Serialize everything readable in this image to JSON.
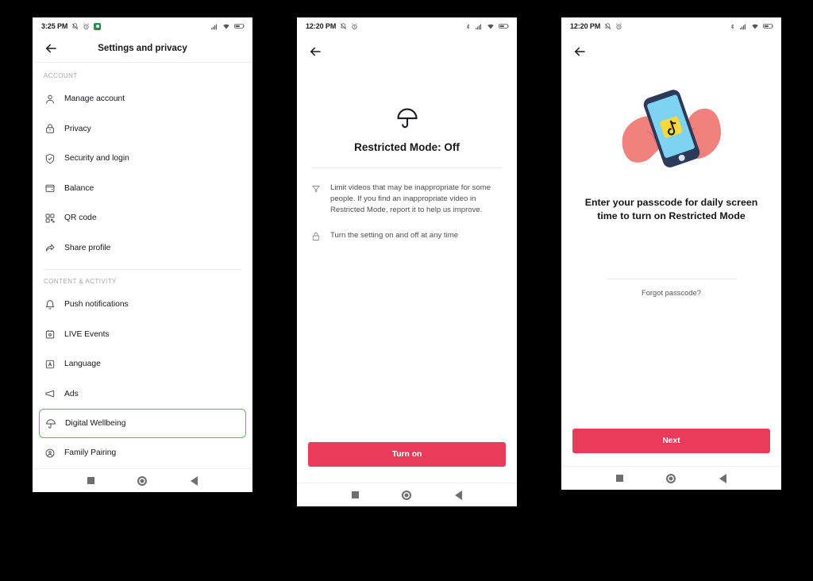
{
  "colors": {
    "accent_red": "#EB3B5A",
    "highlight_green": "#5CB85C",
    "page_background": "#000000",
    "screen_background": "#FFFFFF",
    "hand_pink": "#F2807D",
    "phone_navy": "#2E3A59",
    "phone_screen_blue": "#7FD3F2",
    "logo_yellow": "#FFD93B"
  },
  "screens": {
    "settings": {
      "status_bar": {
        "time": "3:25 PM",
        "left_icons": [
          "bell-mute-icon",
          "alarm-clock-icon",
          "app-badge-icon"
        ],
        "right_icons": [
          "cellular-signal-icon",
          "wifi-icon",
          "battery-icon"
        ]
      },
      "header": {
        "back_label": "Back",
        "title": "Settings and privacy"
      },
      "sections": [
        {
          "label": "ACCOUNT",
          "items": [
            {
              "label": "Manage account",
              "icon": "person-icon",
              "highlighted": false
            },
            {
              "label": "Privacy",
              "icon": "lock-icon",
              "highlighted": false
            },
            {
              "label": "Security and login",
              "icon": "shield-check-icon",
              "highlighted": false
            },
            {
              "label": "Balance",
              "icon": "wallet-icon",
              "highlighted": false
            },
            {
              "label": "QR code",
              "icon": "qr-code-icon",
              "highlighted": false
            },
            {
              "label": "Share profile",
              "icon": "share-arrow-icon",
              "highlighted": false
            }
          ]
        },
        {
          "label": "CONTENT & ACTIVITY",
          "items": [
            {
              "label": "Push notifications",
              "icon": "bell-icon",
              "highlighted": false
            },
            {
              "label": "LIVE Events",
              "icon": "calendar-icon",
              "highlighted": false
            },
            {
              "label": "Language",
              "icon": "letter-a-box-icon",
              "highlighted": false
            },
            {
              "label": "Ads",
              "icon": "megaphone-icon",
              "highlighted": false
            },
            {
              "label": "Digital Wellbeing",
              "icon": "umbrella-icon",
              "highlighted": true
            },
            {
              "label": "Family Pairing",
              "icon": "family-icon",
              "highlighted": false
            }
          ]
        }
      ],
      "nav_bar": {
        "recent_label": "Recents",
        "home_label": "Home",
        "back_label": "Back"
      }
    },
    "restricted_mode": {
      "status_bar": {
        "time": "12:20 PM",
        "left_icons": [
          "bell-mute-icon",
          "alarm-clock-icon"
        ],
        "right_icons": [
          "bluetooth-icon",
          "cellular-signal-icon",
          "wifi-icon",
          "battery-icon"
        ]
      },
      "header": {
        "back_label": "Back",
        "title": ""
      },
      "hero_icon": "umbrella-icon",
      "title": "Restricted Mode: Off",
      "bullets": [
        {
          "icon": "filter-funnel-icon",
          "text": "Limit videos that may be inappropriate for some people. If you find an inappropriate video in Restricted Mode, report it to help us improve."
        },
        {
          "icon": "lock-icon",
          "text": "Turn the setting on and off at any time"
        }
      ],
      "primary_button": "Turn on",
      "nav_bar": {
        "recent_label": "Recents",
        "home_label": "Home",
        "back_label": "Back"
      }
    },
    "passcode": {
      "status_bar": {
        "time": "12:20 PM",
        "left_icons": [
          "bell-mute-icon",
          "alarm-clock-icon"
        ],
        "right_icons": [
          "bluetooth-icon",
          "cellular-signal-icon",
          "wifi-icon",
          "battery-icon"
        ]
      },
      "header": {
        "back_label": "Back",
        "title": ""
      },
      "illustration": "hands-holding-phone-illustration",
      "title": "Enter your passcode for daily screen time to turn on Restricted Mode",
      "passcode_input": {
        "value": "",
        "placeholder": ""
      },
      "forgot_link": "Forgot passcode?",
      "primary_button": "Next",
      "nav_bar": {
        "recent_label": "Recents",
        "home_label": "Home",
        "back_label": "Back"
      }
    }
  }
}
